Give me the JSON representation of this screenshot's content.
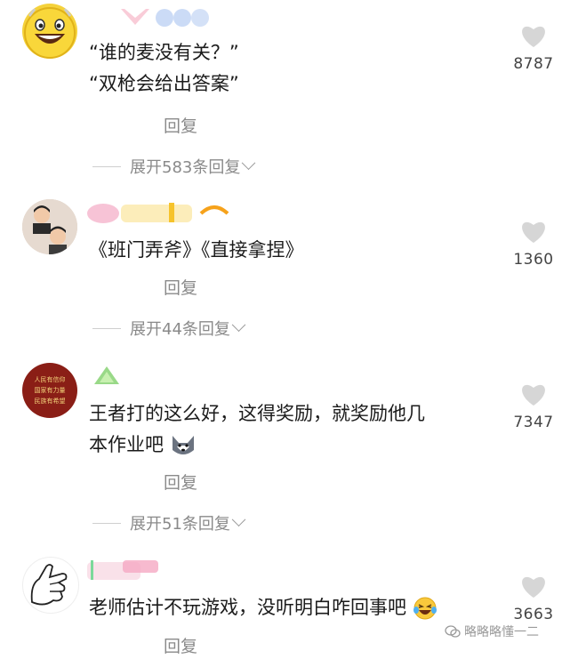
{
  "comments": [
    {
      "text_lines": [
        "“谁的麦没有关？”",
        "“双枪会给出答案”"
      ],
      "reply_label": "回复",
      "expand_label": "展开583条回复",
      "likes": "8787"
    },
    {
      "text_lines": [
        "《班门弄斧》《直接拿捏》"
      ],
      "reply_label": "回复",
      "expand_label": "展开44条回复",
      "likes": "1360"
    },
    {
      "text_lines": [
        "王者打的这么好，这得奖励，就奖励他几",
        "本作业吧"
      ],
      "reply_label": "回复",
      "expand_label": "展开51条回复",
      "likes": "7347",
      "avatar_text": [
        "人民有信仰",
        "国家有力量",
        "民族有希望"
      ]
    },
    {
      "text_lines": [
        "老师估计不玩游戏，没听明白咋回事吧"
      ],
      "reply_label": "回复",
      "likes": "3663"
    }
  ],
  "watermark": "略略略懂一二",
  "colors": {
    "secondary_text": "#8a8a8a",
    "like_icon": "#d6d6d6"
  }
}
